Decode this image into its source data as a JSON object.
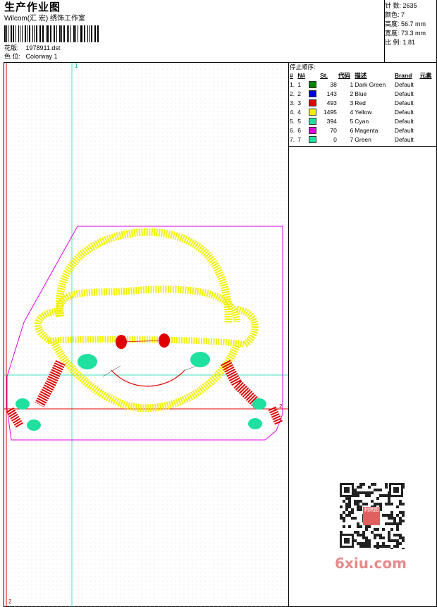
{
  "header": {
    "title": "生产作业图",
    "company": "Wilcom(汇 宏) 绣饰工作室",
    "pattern_label": "花版:",
    "pattern_value": "1978911.dst",
    "color_label": "色 位:",
    "color_value": "Colorway 1"
  },
  "stats": {
    "stitches_label": "针 数:",
    "stitches_value": "2635",
    "colors_label": "颜色:",
    "colors_value": "7",
    "height_label": "高度:",
    "height_value": "56.7 mm",
    "width_label": "宽度:",
    "width_value": "73.3 mm",
    "scale_label": "比 例:",
    "scale_value": "1.81"
  },
  "sequence": {
    "title": "停止顺序:",
    "columns": [
      "#",
      "N#",
      "",
      "St.",
      "代码",
      "描述",
      "Brand",
      "元素"
    ],
    "rows": [
      {
        "idx": "1.",
        "n": "1",
        "color": "#008000",
        "st": "38",
        "code": "1",
        "desc": "Dark Green",
        "brand": "Default"
      },
      {
        "idx": "2.",
        "n": "2",
        "color": "#0000e0",
        "st": "143",
        "code": "2",
        "desc": "Blue",
        "brand": "Default"
      },
      {
        "idx": "3.",
        "n": "3",
        "color": "#e00000",
        "st": "493",
        "code": "3",
        "desc": "Red",
        "brand": "Default"
      },
      {
        "idx": "4.",
        "n": "4",
        "color": "#f0f000",
        "st": "1495",
        "code": "4",
        "desc": "Yellow",
        "brand": "Default"
      },
      {
        "idx": "5.",
        "n": "5",
        "color": "#20e0a0",
        "st": "394",
        "code": "5",
        "desc": "Cyan",
        "brand": "Default"
      },
      {
        "idx": "6.",
        "n": "6",
        "color": "#e000e0",
        "st": "70",
        "code": "6",
        "desc": "Magenta",
        "brand": "Default"
      },
      {
        "idx": "7.",
        "n": "7",
        "color": "#20e0a0",
        "st": "0",
        "code": "7",
        "desc": "Green",
        "brand": "Default"
      }
    ]
  },
  "canvas": {
    "marker_1": "1",
    "marker_2a": "2",
    "marker_2b": "2"
  },
  "watermark": {
    "qr_center_text": "刺绣图",
    "site": "6xiu.com"
  }
}
